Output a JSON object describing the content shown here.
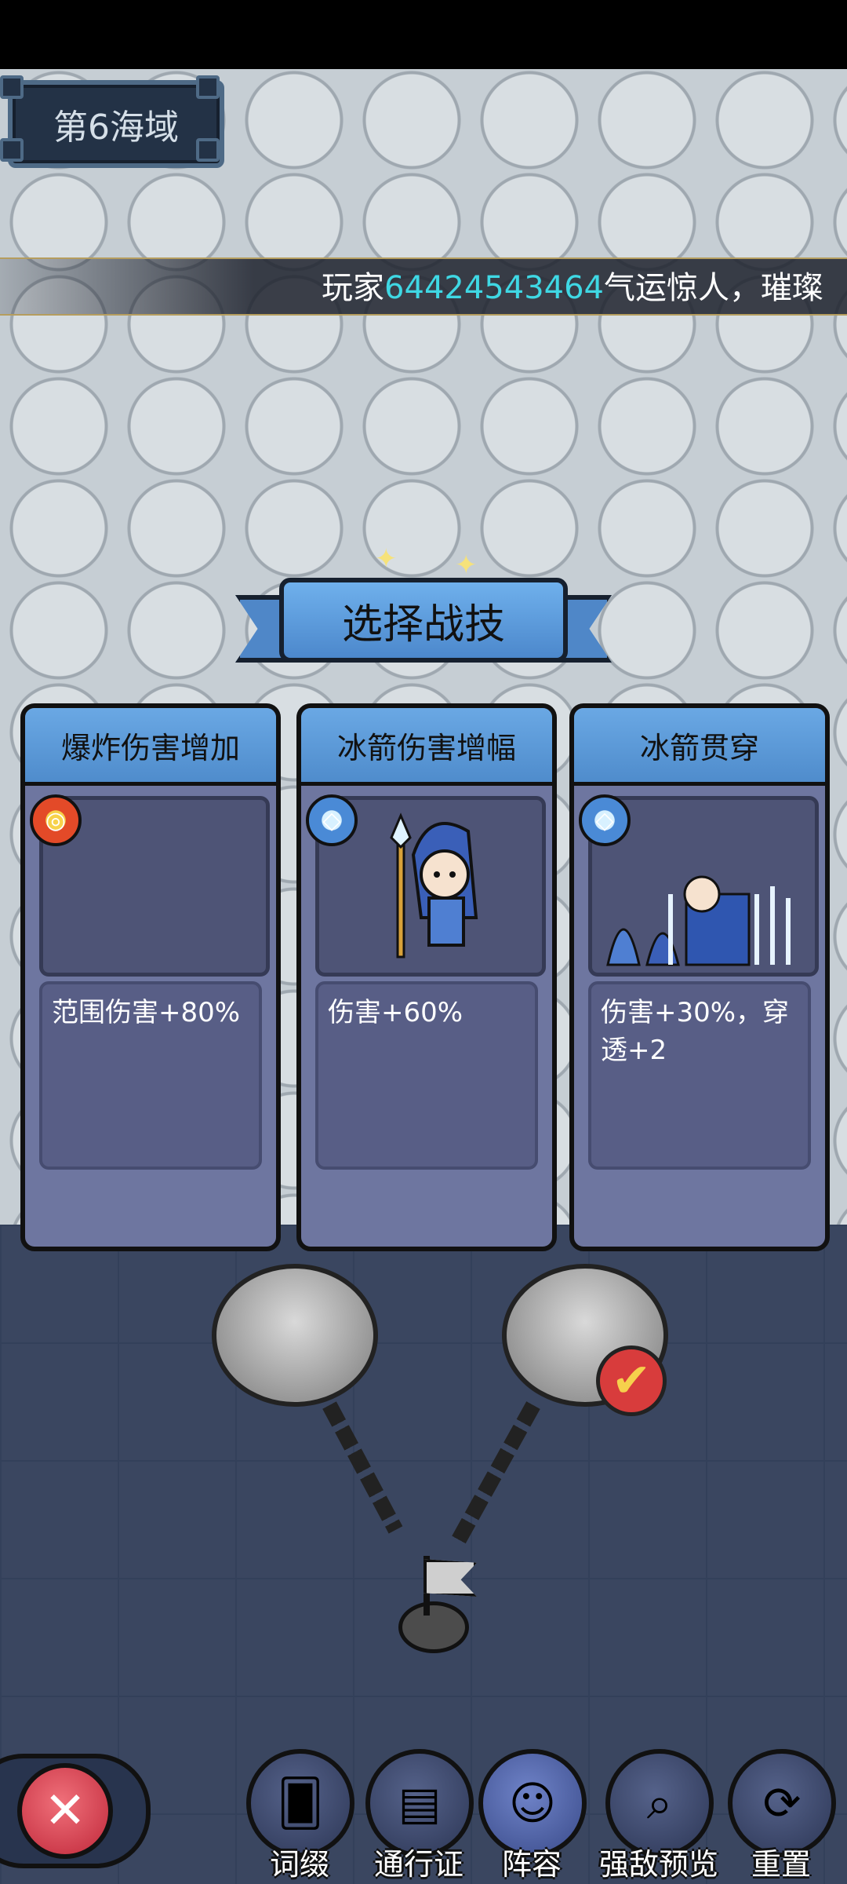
{
  "region": {
    "label": "第6海域"
  },
  "ticker": {
    "prefix": "玩家",
    "player_id": "64424543464",
    "suffix": "气运惊人，璀璨"
  },
  "selector": {
    "title": "选择战技",
    "cards": [
      {
        "title": "爆炸伤害增加",
        "icon": "explosion-icon",
        "description": "范围伤害+80%"
      },
      {
        "title": "冰箭伤害增幅",
        "icon": "ice-arrow-icon",
        "description": "伤害+60%"
      },
      {
        "title": "冰箭贯穿",
        "icon": "ice-arrow-icon",
        "description": "伤害+30%，穿透+2"
      }
    ]
  },
  "bottom_nav": {
    "close_icon": "close-icon",
    "items": [
      {
        "label": "词缀",
        "icon": "card-icon"
      },
      {
        "label": "通行证",
        "icon": "passport-icon"
      },
      {
        "label": "阵容",
        "icon": "hero-icon"
      },
      {
        "label": "强敌预览",
        "icon": "magnifier-icon"
      },
      {
        "label": "重置",
        "icon": "refresh-icon"
      }
    ]
  }
}
